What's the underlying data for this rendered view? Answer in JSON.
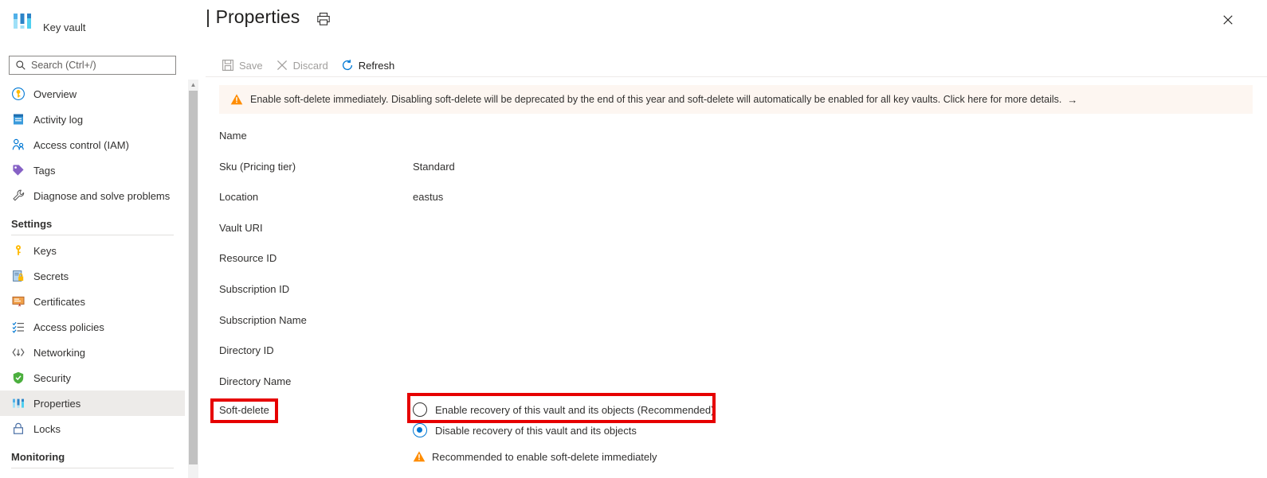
{
  "brand": {
    "label": "Key vault",
    "logo_icon": "key-vault-logo-icon"
  },
  "search": {
    "placeholder": "Search (Ctrl+/)",
    "value": "",
    "icon": "search-icon"
  },
  "collapse": {
    "label": "«"
  },
  "sidebar": {
    "items": [
      {
        "label": "Overview",
        "icon": "overview-key-icon",
        "selected": false
      },
      {
        "label": "Activity log",
        "icon": "activity-log-icon",
        "selected": false
      },
      {
        "label": "Access control (IAM)",
        "icon": "access-control-person-icon",
        "selected": false
      },
      {
        "label": "Tags",
        "icon": "tags-icon",
        "selected": false
      },
      {
        "label": "Diagnose and solve problems",
        "icon": "wrench-icon",
        "selected": false
      }
    ],
    "group_settings": "Settings",
    "settings_items": [
      {
        "label": "Keys",
        "icon": "key-icon",
        "selected": false
      },
      {
        "label": "Secrets",
        "icon": "secrets-icon",
        "selected": false
      },
      {
        "label": "Certificates",
        "icon": "certificate-icon",
        "selected": false
      },
      {
        "label": "Access policies",
        "icon": "access-policies-icon",
        "selected": false
      },
      {
        "label": "Networking",
        "icon": "networking-icon",
        "selected": false
      },
      {
        "label": "Security",
        "icon": "shield-icon",
        "selected": false
      },
      {
        "label": "Properties",
        "icon": "properties-bars-icon",
        "selected": true
      },
      {
        "label": "Locks",
        "icon": "lock-icon",
        "selected": false
      }
    ],
    "group_monitoring": "Monitoring"
  },
  "header": {
    "title": "| Properties",
    "print_icon": "print-icon",
    "close_icon": "close-icon"
  },
  "command_bar": {
    "save_label": "Save",
    "save_icon": "save-disk-icon",
    "save_disabled": true,
    "discard_label": "Discard",
    "discard_icon": "discard-x-icon",
    "discard_disabled": true,
    "refresh_label": "Refresh",
    "refresh_icon": "refresh-circular-arrow-icon",
    "refresh_disabled": false
  },
  "banner": {
    "icon": "warning-triangle-icon",
    "text": "Enable soft-delete immediately. Disabling soft-delete will be deprecated by the end of this year and soft-delete will automatically be enabled for all key vaults. Click here for more details.",
    "arrow": "→",
    "background_color": "#fdf6f1",
    "icon_color": "#ff8c00"
  },
  "properties": [
    {
      "label": "Name",
      "value": ""
    },
    {
      "label": "Sku (Pricing tier)",
      "value": "Standard"
    },
    {
      "label": "Location",
      "value": "eastus"
    },
    {
      "label": "Vault URI",
      "value": ""
    },
    {
      "label": "Resource ID",
      "value": ""
    },
    {
      "label": "Subscription ID",
      "value": ""
    },
    {
      "label": "Subscription Name",
      "value": ""
    },
    {
      "label": "Directory ID",
      "value": ""
    },
    {
      "label": "Directory Name",
      "value": ""
    }
  ],
  "soft_delete": {
    "label": "Soft-delete",
    "options": [
      {
        "label": "Enable recovery of this vault and its objects (Recommended)",
        "selected": false
      },
      {
        "label": "Disable recovery of this vault and its objects",
        "selected": true
      }
    ],
    "note_icon": "warning-triangle-icon",
    "note_text": "Recommended to enable soft-delete immediately",
    "accent_color": "#0078d4"
  },
  "annotations": {
    "color": "#e60000",
    "boxes": [
      {
        "name": "soft-delete-label-highlight"
      },
      {
        "name": "enable-recovery-radio-highlight"
      }
    ]
  }
}
